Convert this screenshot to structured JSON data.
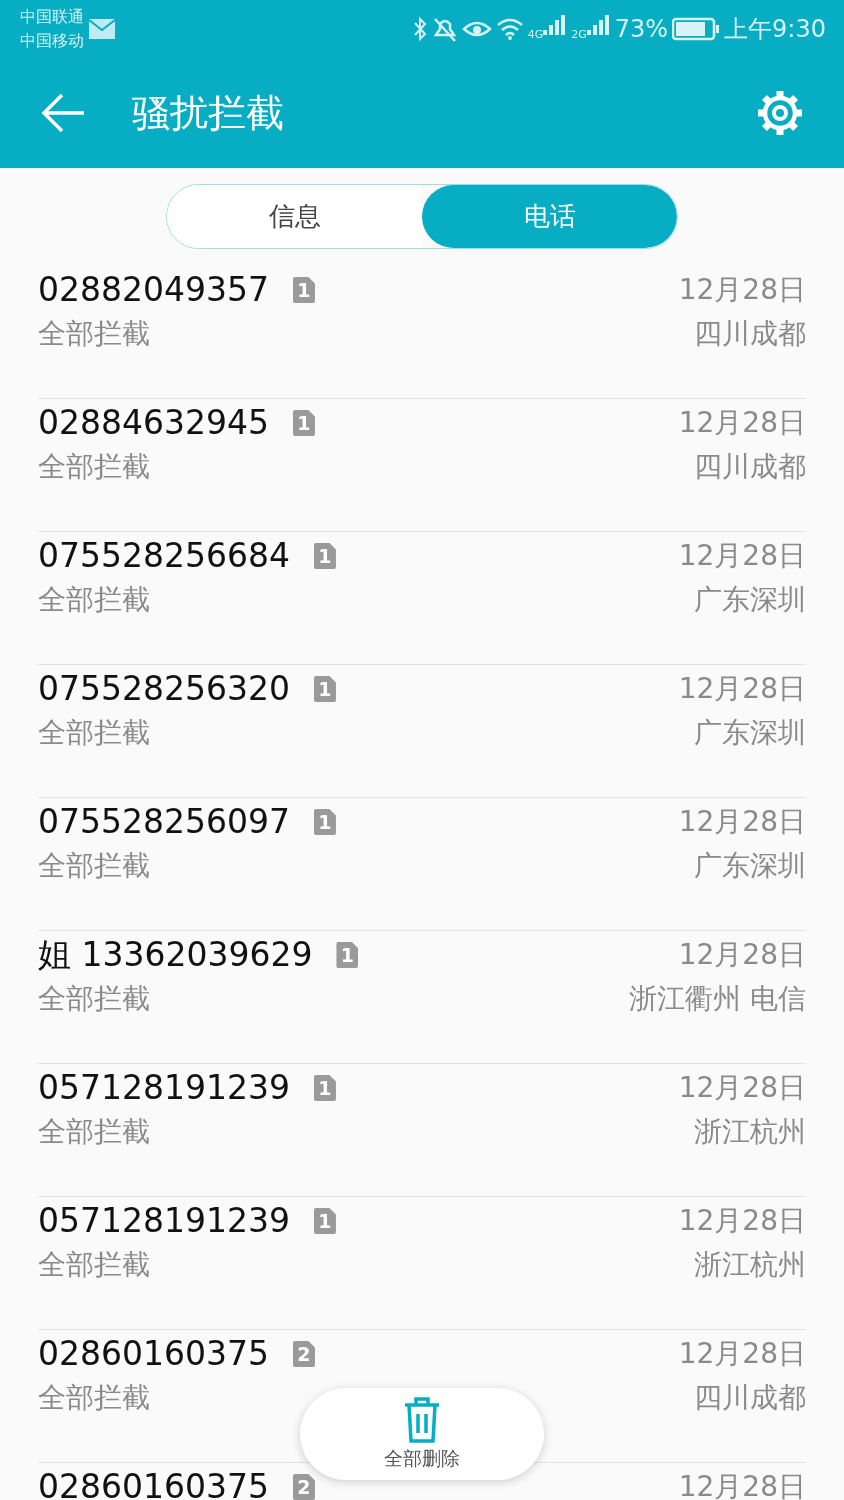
{
  "status_bar": {
    "carriers": [
      "中国联通",
      "中国移动"
    ],
    "net1": "4G",
    "net2": "2G",
    "battery": "73%",
    "time": "上午9:30"
  },
  "app_bar": {
    "title": "骚扰拦截"
  },
  "tabs": [
    {
      "label": "信息",
      "selected": false
    },
    {
      "label": "电话",
      "selected": true
    }
  ],
  "calls": [
    {
      "number": "02882049357",
      "sim": "1",
      "rule": "全部拦截",
      "date": "12月28日",
      "location": "四川成都"
    },
    {
      "number": "02884632945",
      "sim": "1",
      "rule": "全部拦截",
      "date": "12月28日",
      "location": "四川成都"
    },
    {
      "number": "075528256684",
      "sim": "1",
      "rule": "全部拦截",
      "date": "12月28日",
      "location": "广东深圳"
    },
    {
      "number": "075528256320",
      "sim": "1",
      "rule": "全部拦截",
      "date": "12月28日",
      "location": "广东深圳"
    },
    {
      "number": "075528256097",
      "sim": "1",
      "rule": "全部拦截",
      "date": "12月28日",
      "location": "广东深圳"
    },
    {
      "number": "姐 13362039629",
      "sim": "1",
      "rule": "全部拦截",
      "date": "12月28日",
      "location": "浙江衢州 电信"
    },
    {
      "number": "057128191239",
      "sim": "1",
      "rule": "全部拦截",
      "date": "12月28日",
      "location": "浙江杭州"
    },
    {
      "number": "057128191239",
      "sim": "1",
      "rule": "全部拦截",
      "date": "12月28日",
      "location": "浙江杭州"
    },
    {
      "number": "02860160375",
      "sim": "2",
      "rule": "全部拦截",
      "date": "12月28日",
      "location": "四川成都"
    },
    {
      "number": "02860160375",
      "sim": "2",
      "date": "12月28日"
    }
  ],
  "delete_all": {
    "label": "全部删除"
  }
}
